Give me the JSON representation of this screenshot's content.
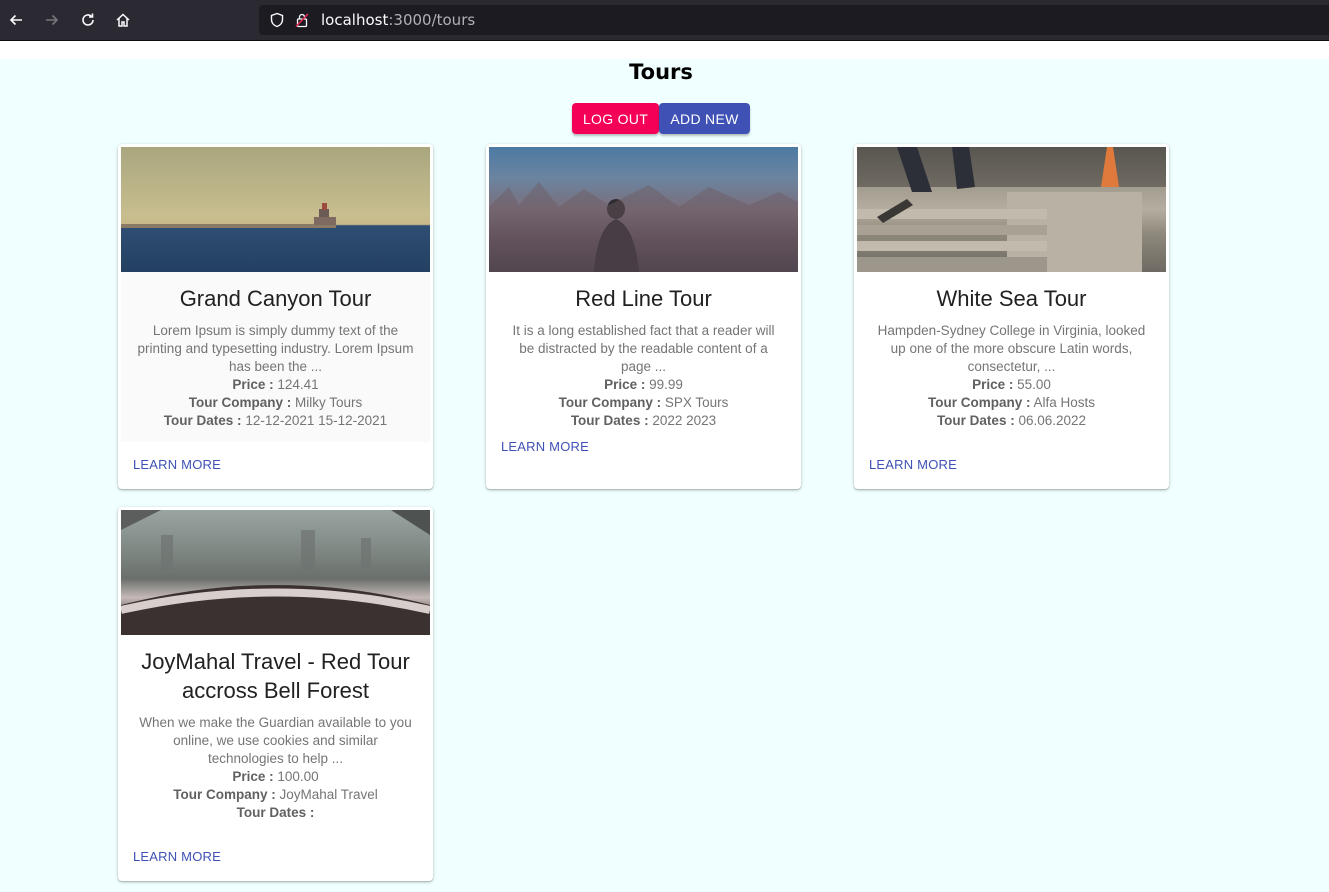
{
  "browser": {
    "url_host": "localhost",
    "url_path": ":3000/tours"
  },
  "page": {
    "title": "Tours",
    "logout_label": "LOG OUT",
    "add_new_label": "ADD NEW"
  },
  "labels": {
    "price": "Price :",
    "company": "Tour Company :",
    "dates": "Tour Dates :",
    "learn_more": "LEARN MORE"
  },
  "tours": [
    {
      "title": "Grand Canyon Tour",
      "description": "Lorem Ipsum is simply dummy text of the printing and typesetting industry. Lorem Ipsum has been the ...",
      "price": "124.41",
      "company": "Milky Tours",
      "dates": "12-12-2021 15-12-2021",
      "image": "lighthouse-sea-image"
    },
    {
      "title": "Red Line Tour",
      "description": "It is a long established fact that a reader will be distracted by the readable content of a page ...",
      "price": "99.99",
      "company": "SPX Tours",
      "dates": "2022 2023",
      "image": "person-field-image"
    },
    {
      "title": "White Sea Tour",
      "description": "Hampden-Sydney College in Virginia, looked up one of the more obscure Latin words, consectetur, ...",
      "price": "55.00",
      "company": "Alfa Hosts",
      "dates": "06.06.2022",
      "image": "skateboard-steps-image"
    },
    {
      "title": "JoyMahal Travel - Red Tour accross Bell Forest",
      "description": "When we make the Guardian available to you online, we use cookies and similar technologies to help ...",
      "price": "100.00",
      "company": "JoyMahal Travel",
      "dates": "",
      "image": "city-window-image"
    }
  ],
  "colors": {
    "background": "#f0ffff",
    "logout": "#f50057",
    "add_new": "#3f51b5",
    "link": "#3f51b5"
  }
}
